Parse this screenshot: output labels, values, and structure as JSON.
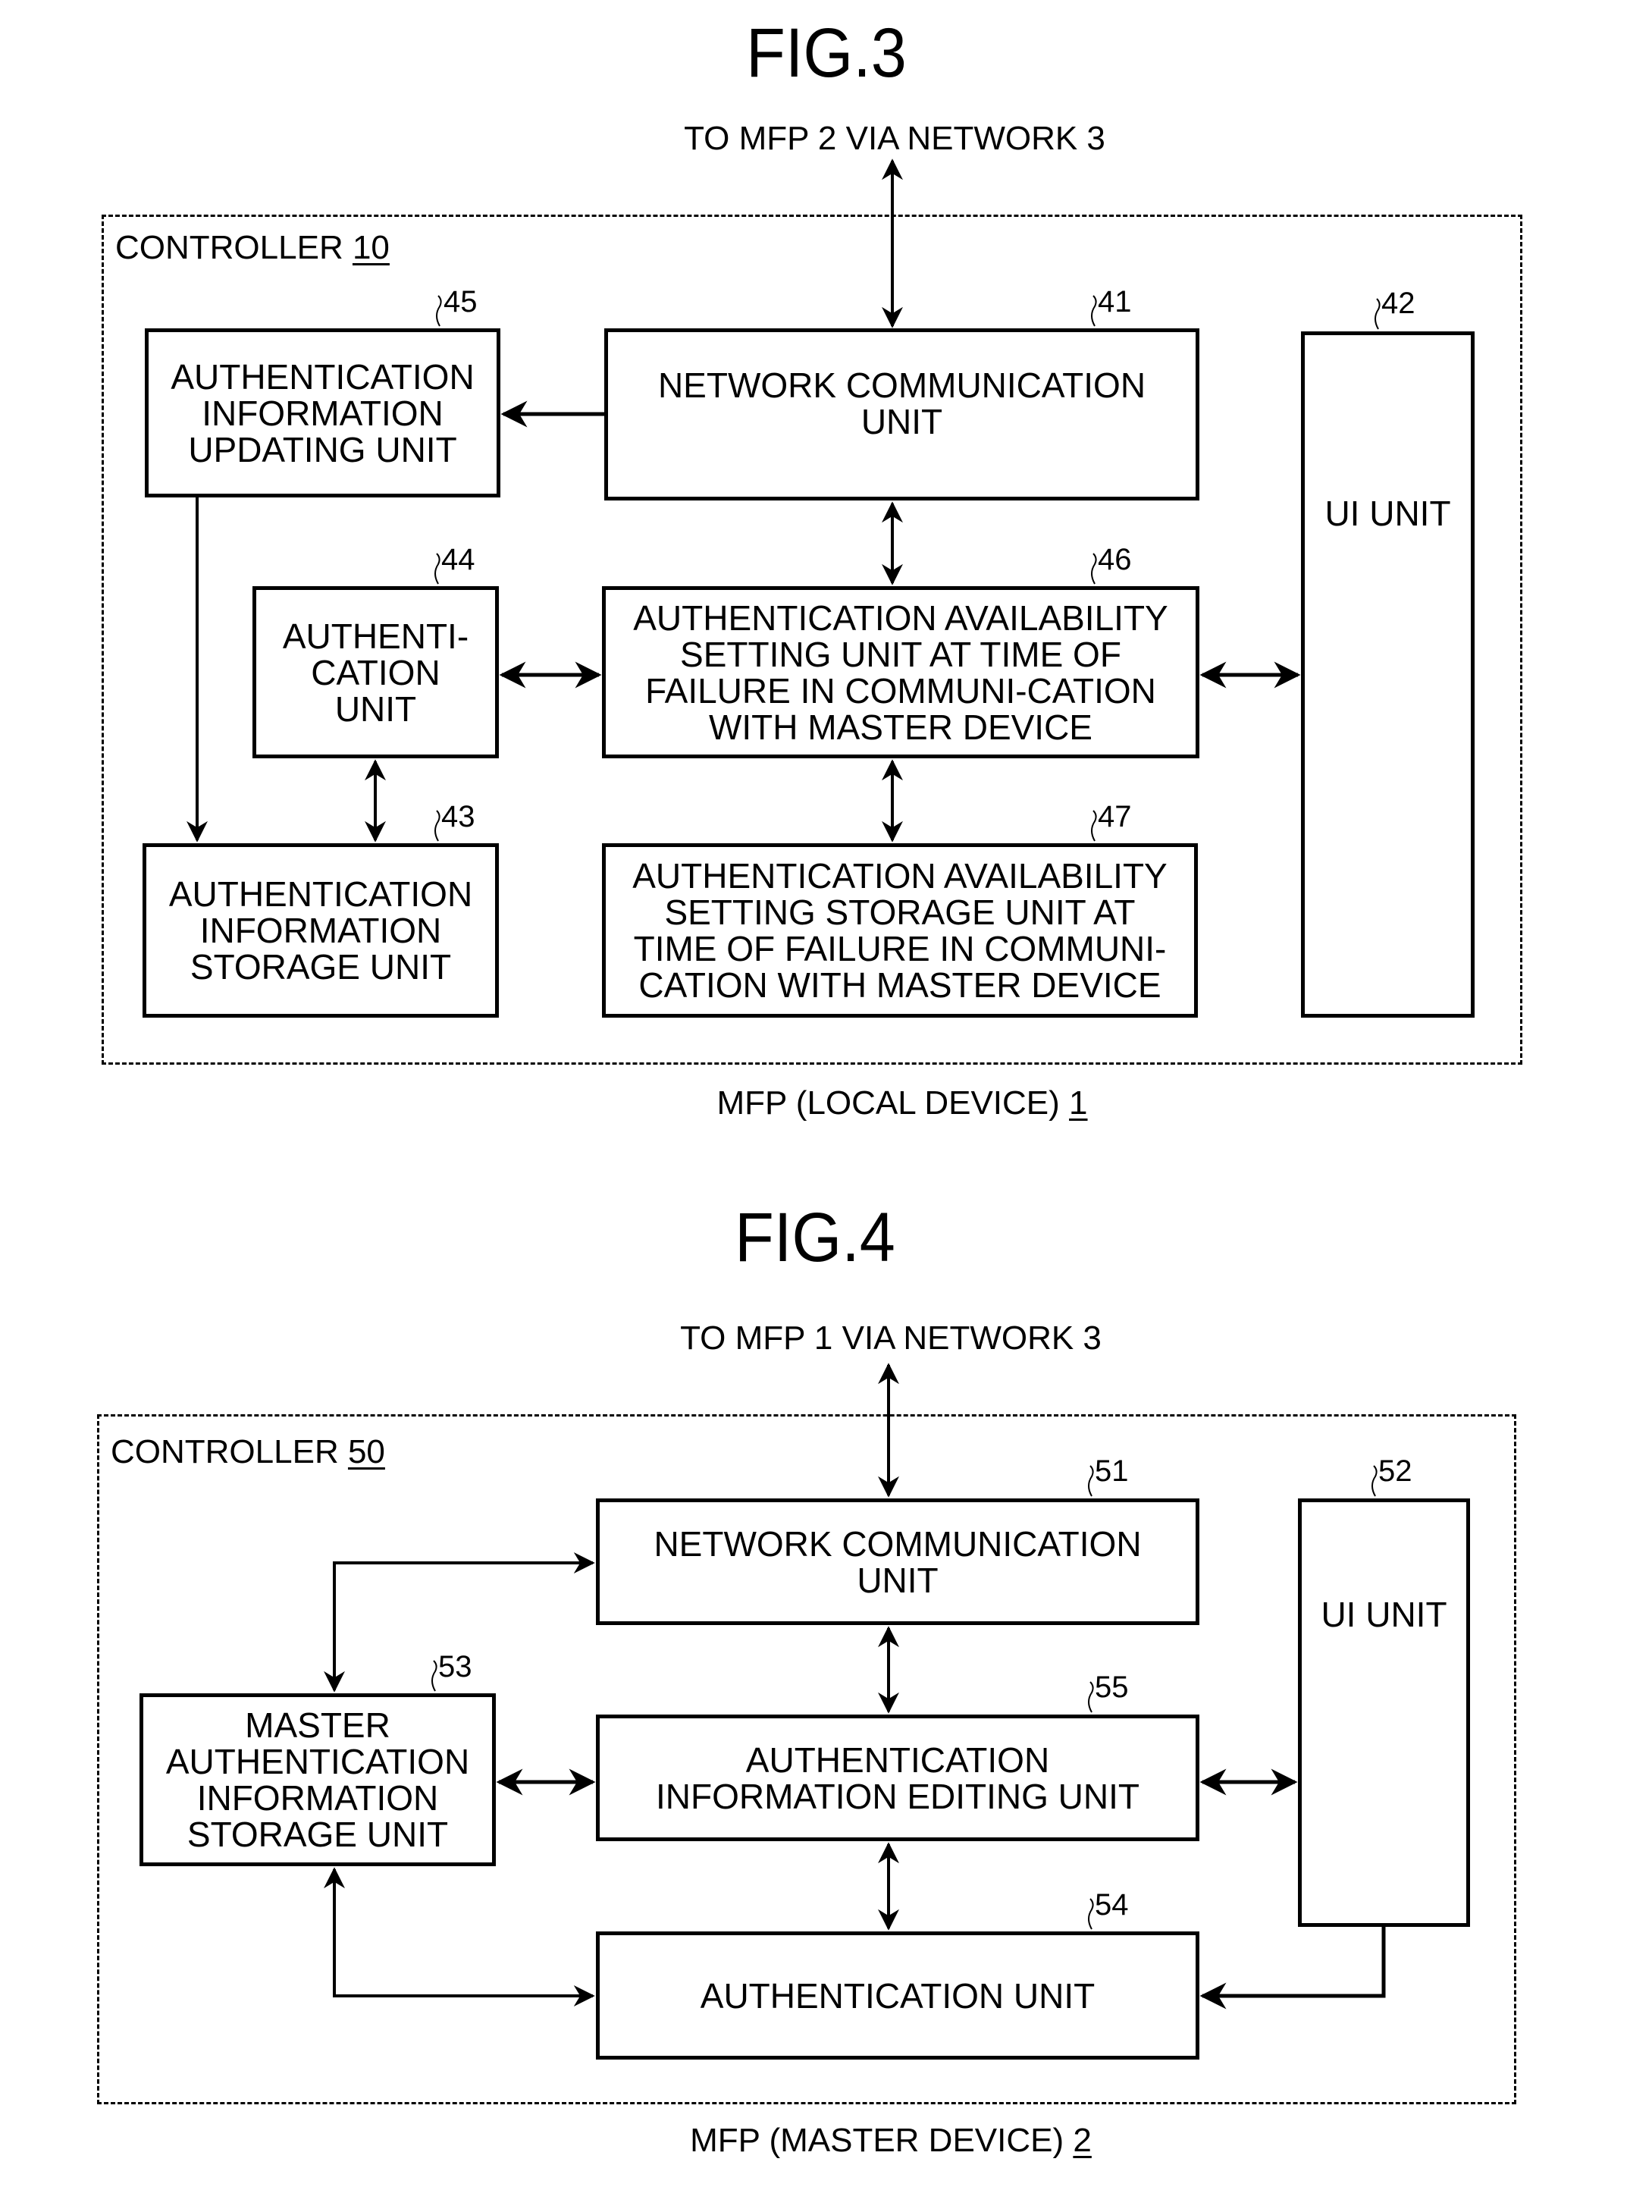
{
  "figures": [
    {
      "title": "FIG.3",
      "network_caption": "TO MFP 2 VIA NETWORK 3",
      "controller_label": "CONTROLLER ",
      "controller_ref": "10",
      "device_caption": "MFP (LOCAL DEVICE) ",
      "device_ref": "1",
      "blocks": {
        "b45": {
          "ref": "45",
          "label": "AUTHENTICATION\nINFORMATION\nUPDATING UNIT"
        },
        "b41": {
          "ref": "41",
          "label": "NETWORK COMMUNICATION\nUNIT"
        },
        "b42": {
          "ref": "42",
          "label": "UI UNIT"
        },
        "b44": {
          "ref": "44",
          "label": "AUTHENTI-\nCATION\nUNIT"
        },
        "b46": {
          "ref": "46",
          "label": "AUTHENTICATION AVAILABILITY\nSETTING UNIT AT TIME OF\nFAILURE IN COMMUNI-CATION\nWITH MASTER DEVICE"
        },
        "b43": {
          "ref": "43",
          "label": "AUTHENTICATION\nINFORMATION\nSTORAGE UNIT"
        },
        "b47": {
          "ref": "47",
          "label": "AUTHENTICATION AVAILABILITY\nSETTING STORAGE UNIT AT\nTIME OF FAILURE IN COMMUNI-\nCATION WITH MASTER DEVICE"
        }
      }
    },
    {
      "title": "FIG.4",
      "network_caption": "TO MFP 1 VIA NETWORK 3",
      "controller_label": "CONTROLLER ",
      "controller_ref": "50",
      "device_caption": "MFP (MASTER DEVICE) ",
      "device_ref": "2",
      "blocks": {
        "b51": {
          "ref": "51",
          "label": "NETWORK COMMUNICATION\nUNIT"
        },
        "b52": {
          "ref": "52",
          "label": "UI UNIT"
        },
        "b53": {
          "ref": "53",
          "label": "MASTER\nAUTHENTICATION\nINFORMATION\nSTORAGE UNIT"
        },
        "b55": {
          "ref": "55",
          "label": "AUTHENTICATION\nINFORMATION EDITING UNIT"
        },
        "b54": {
          "ref": "54",
          "label": "AUTHENTICATION UNIT"
        }
      }
    }
  ]
}
